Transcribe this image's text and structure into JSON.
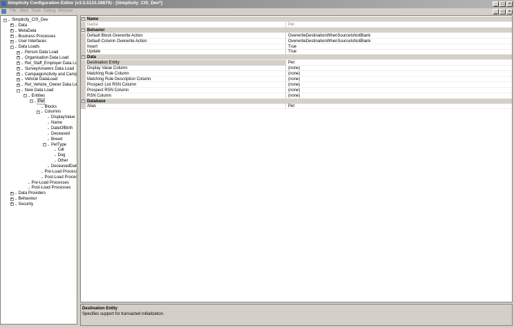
{
  "window": {
    "title": "Simplicity Configuration Editor (v3.5.5123.28879) - [Simplicity_CIS_Dev*]"
  },
  "menu": [
    "File",
    "View",
    "Tools",
    "Debug",
    "Window"
  ],
  "tree": [
    {
      "label": "Simplicity_CIS_Dev",
      "level": 0,
      "exp": "-"
    },
    {
      "label": "Data",
      "level": 1,
      "exp": "+"
    },
    {
      "label": "MetaData",
      "level": 1,
      "exp": "+"
    },
    {
      "label": "Business Processes",
      "level": 1,
      "exp": "+"
    },
    {
      "label": "User Interfaces",
      "level": 1,
      "exp": "+"
    },
    {
      "label": "Data Loads",
      "level": 1,
      "exp": "-"
    },
    {
      "label": "Person Data Load",
      "level": 2,
      "exp": "+"
    },
    {
      "label": "Organisation Data Load",
      "level": 2,
      "exp": "+"
    },
    {
      "label": "Rel_Staff_Employer Data Load",
      "level": 2,
      "exp": "+"
    },
    {
      "label": "SurveyAnswers Data Load",
      "level": 2,
      "exp": "+"
    },
    {
      "label": "CampaignActivity and Campaign",
      "level": 2,
      "exp": "+"
    },
    {
      "label": "Vehicle DataLoad",
      "level": 2,
      "exp": "+"
    },
    {
      "label": "Rel_Vehicle_Owner Data Load",
      "level": 2,
      "exp": "+"
    },
    {
      "label": "New Data Load",
      "level": 2,
      "exp": "-"
    },
    {
      "label": "Entities",
      "level": 3,
      "exp": "-"
    },
    {
      "label": "Pet",
      "level": 4,
      "exp": "-",
      "selected": true
    },
    {
      "label": "Blocks",
      "level": 5,
      "exp": ""
    },
    {
      "label": "Columns",
      "level": 5,
      "exp": "-"
    },
    {
      "label": "DisplayValue",
      "level": 6,
      "exp": ""
    },
    {
      "label": "Name",
      "level": 6,
      "exp": ""
    },
    {
      "label": "DateOfBirth",
      "level": 6,
      "exp": ""
    },
    {
      "label": "Deceased",
      "level": 6,
      "exp": ""
    },
    {
      "label": "Breed",
      "level": 6,
      "exp": ""
    },
    {
      "label": "PetType",
      "level": 6,
      "exp": "-"
    },
    {
      "label": "Cat",
      "level": 7,
      "exp": ""
    },
    {
      "label": "Dog",
      "level": 7,
      "exp": ""
    },
    {
      "label": "Other",
      "level": 7,
      "exp": ""
    },
    {
      "label": "DeceasedDate",
      "level": 6,
      "exp": ""
    },
    {
      "label": "Pre-Load Processes",
      "level": 5,
      "exp": ""
    },
    {
      "label": "Post-Load Processes",
      "level": 5,
      "exp": ""
    },
    {
      "label": "Pre-Load Processes",
      "level": 3,
      "exp": ""
    },
    {
      "label": "Post-Load Processes",
      "level": 3,
      "exp": ""
    },
    {
      "label": "Data Providers",
      "level": 1,
      "exp": "+"
    },
    {
      "label": "Behaviour",
      "level": 1,
      "exp": "+"
    },
    {
      "label": "Security",
      "level": 1,
      "exp": "+"
    }
  ],
  "grid": [
    {
      "type": "cat",
      "name": "Name"
    },
    {
      "type": "prop",
      "name": "Name",
      "value": "Pet",
      "gray": true
    },
    {
      "type": "cat",
      "name": "Behavior"
    },
    {
      "type": "prop",
      "name": "Default Block Overwrite Action",
      "value": "OverwriteDestinationWhenSourceIsNotBlank"
    },
    {
      "type": "prop",
      "name": "Default Column Overwrite Action",
      "value": "OverwriteDestinationWhenSourceIsNotBlank"
    },
    {
      "type": "prop",
      "name": "Insert",
      "value": "True"
    },
    {
      "type": "prop",
      "name": "Update",
      "value": "True"
    },
    {
      "type": "cat",
      "name": "Data"
    },
    {
      "type": "prop",
      "name": "Destination Entity",
      "value": "Pet",
      "selected": true
    },
    {
      "type": "prop",
      "name": "Display Value Column",
      "value": "(none)"
    },
    {
      "type": "prop",
      "name": "Matching Rule Column",
      "value": "(none)"
    },
    {
      "type": "prop",
      "name": "Matching Rule Description Column",
      "value": "(none)"
    },
    {
      "type": "prop",
      "name": "Prospect List RSN Column",
      "value": "(none)"
    },
    {
      "type": "prop",
      "name": "Prospect RSN Column",
      "value": "(none)"
    },
    {
      "type": "prop",
      "name": "RSN Column",
      "value": "(none)"
    },
    {
      "type": "cat",
      "name": "Database"
    },
    {
      "type": "prop",
      "name": "Alias",
      "value": "Pet"
    }
  ],
  "description": {
    "title": "Destination Entity",
    "text": "Specifies support for transacted initialization."
  }
}
